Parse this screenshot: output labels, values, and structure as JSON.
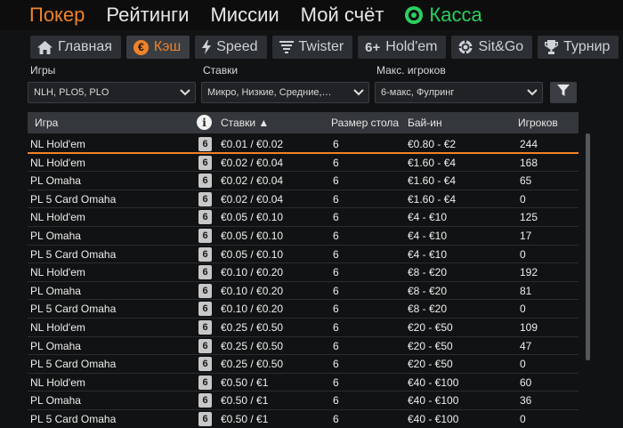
{
  "topnav": {
    "items": [
      {
        "label": "Покер",
        "active": true
      },
      {
        "label": "Рейтинги"
      },
      {
        "label": "Миссии"
      },
      {
        "label": "Мой счёт"
      }
    ],
    "cashier": "Касса"
  },
  "tabs": [
    {
      "label": "Главная",
      "icon": "home-icon"
    },
    {
      "label": "Кэш",
      "icon": "euro-icon",
      "active": true
    },
    {
      "label": "Speed",
      "icon": "lightning-icon"
    },
    {
      "label": "Twister",
      "icon": "tornado-icon"
    },
    {
      "label": "Hold'em",
      "icon": "six-plus-icon",
      "icon_text": "6+"
    },
    {
      "label": "Sit&Go",
      "icon": "poker-chip-icon"
    },
    {
      "label": "Турнир",
      "icon": "trophy-icon"
    }
  ],
  "filters": {
    "games": {
      "label": "Игры",
      "value": "NLH, PLO5, PLO"
    },
    "stakes": {
      "label": "Ставки",
      "value": "Микро, Низкие, Средние,…"
    },
    "max_players": {
      "label": "Макс. игроков",
      "value": "6-макс, Фулринг"
    }
  },
  "table": {
    "columns": {
      "game": "Игра",
      "stakes": "Ставки ▲",
      "table_size": "Размер стола",
      "buyin": "Бай-ин",
      "players": "Игроков"
    },
    "rows": [
      {
        "game": "NL Hold'em",
        "seats": "6",
        "stakes": "€0.01 / €0.02",
        "size": "6",
        "buyin": "€0.80 - €2",
        "players": "244"
      },
      {
        "game": "NL Hold'em",
        "seats": "6",
        "stakes": "€0.02 / €0.04",
        "size": "6",
        "buyin": "€1.60 - €4",
        "players": "168"
      },
      {
        "game": "PL Omaha",
        "seats": "6",
        "stakes": "€0.02 / €0.04",
        "size": "6",
        "buyin": "€1.60 - €4",
        "players": "65"
      },
      {
        "game": "PL 5 Card Omaha",
        "seats": "6",
        "stakes": "€0.02 / €0.04",
        "size": "6",
        "buyin": "€1.60 - €4",
        "players": "0"
      },
      {
        "game": "NL Hold'em",
        "seats": "6",
        "stakes": "€0.05 / €0.10",
        "size": "6",
        "buyin": "€4 - €10",
        "players": "125"
      },
      {
        "game": "PL Omaha",
        "seats": "6",
        "stakes": "€0.05 / €0.10",
        "size": "6",
        "buyin": "€4 - €10",
        "players": "17"
      },
      {
        "game": "PL 5 Card Omaha",
        "seats": "6",
        "stakes": "€0.05 / €0.10",
        "size": "6",
        "buyin": "€4 - €10",
        "players": "0"
      },
      {
        "game": "NL Hold'em",
        "seats": "6",
        "stakes": "€0.10 / €0.20",
        "size": "6",
        "buyin": "€8 - €20",
        "players": "192"
      },
      {
        "game": "PL Omaha",
        "seats": "6",
        "stakes": "€0.10 / €0.20",
        "size": "6",
        "buyin": "€8 - €20",
        "players": "81"
      },
      {
        "game": "PL 5 Card Omaha",
        "seats": "6",
        "stakes": "€0.10 / €0.20",
        "size": "6",
        "buyin": "€8 - €20",
        "players": "0"
      },
      {
        "game": "NL Hold'em",
        "seats": "6",
        "stakes": "€0.25 / €0.50",
        "size": "6",
        "buyin": "€20 - €50",
        "players": "109"
      },
      {
        "game": "PL Omaha",
        "seats": "6",
        "stakes": "€0.25 / €0.50",
        "size": "6",
        "buyin": "€20 - €50",
        "players": "47"
      },
      {
        "game": "PL 5 Card Omaha",
        "seats": "6",
        "stakes": "€0.25 / €0.50",
        "size": "6",
        "buyin": "€20 - €50",
        "players": "0"
      },
      {
        "game": "NL Hold'em",
        "seats": "6",
        "stakes": "€0.50 / €1",
        "size": "6",
        "buyin": "€40 - €100",
        "players": "60"
      },
      {
        "game": "PL Omaha",
        "seats": "6",
        "stakes": "€0.50 / €1",
        "size": "6",
        "buyin": "€40 - €100",
        "players": "36"
      },
      {
        "game": "PL 5 Card Omaha",
        "seats": "6",
        "stakes": "€0.50 / €1",
        "size": "6",
        "buyin": "€40 - €100",
        "players": "0"
      }
    ]
  },
  "colors": {
    "accent": "#f0822a",
    "cashier": "#2bd05f"
  }
}
